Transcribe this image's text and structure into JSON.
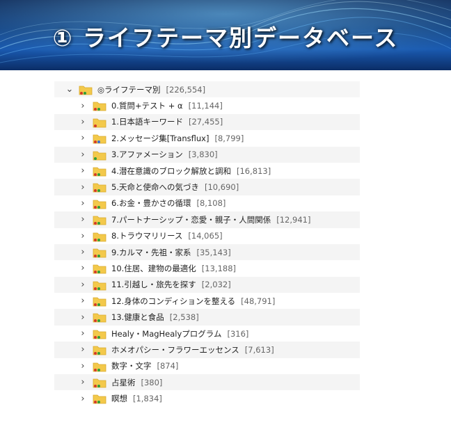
{
  "banner": {
    "title": "① ライフテーマ別データベース"
  },
  "colors": {
    "folder": "#f3c94b",
    "dot_red": "#d43a2a",
    "dot_green": "#2f9e3a",
    "dot_blue": "#3a6fd4"
  },
  "tree": {
    "root": {
      "label": "◎ライフテーマ別",
      "count": "[226,554]"
    },
    "items": [
      {
        "label": "0.質問+テスト + α",
        "count": "[11,144]",
        "dots": [
          "red",
          "green"
        ]
      },
      {
        "label": "1.日本語キーワード",
        "count": "[27,455]",
        "dots": [
          "red"
        ]
      },
      {
        "label": "2.メッセージ集[Transflux]",
        "count": "[8,799]",
        "dots": [
          "red",
          "blue"
        ]
      },
      {
        "label": "3.アファメーション",
        "count": "[3,830]",
        "dots": [
          "green"
        ]
      },
      {
        "label": "4.潜在意識のブロック解放と調和",
        "count": "[16,813]",
        "dots": [
          "red",
          "green"
        ]
      },
      {
        "label": "5.天命と使命への気づき",
        "count": "[10,690]",
        "dots": [
          "red",
          "green"
        ]
      },
      {
        "label": "6.お金・豊かさの循環",
        "count": "[8,108]",
        "dots": [
          "red",
          "green"
        ]
      },
      {
        "label": "7.パートナーシップ・恋愛・親子・人間関係",
        "count": "[12,941]",
        "dots": [
          "red",
          "green"
        ]
      },
      {
        "label": "8.トラウマリリース",
        "count": "[14,065]",
        "dots": [
          "red",
          "green"
        ]
      },
      {
        "label": "9.カルマ・先祖・家系",
        "count": "[35,143]",
        "dots": [
          "red",
          "green"
        ]
      },
      {
        "label": "10.住居、建物の最適化",
        "count": "[13,188]",
        "dots": [
          "red",
          "green"
        ]
      },
      {
        "label": "11.引越し・旅先を探す",
        "count": "[2,032]",
        "dots": [
          "red",
          "green"
        ]
      },
      {
        "label": "12.身体のコンディションを整える",
        "count": "[48,791]",
        "dots": [
          "red",
          "green"
        ]
      },
      {
        "label": "13.健康と食品",
        "count": "[2,538]",
        "dots": [
          "red",
          "green"
        ]
      },
      {
        "label": "Healy・MagHealyプログラム",
        "count": "[316]",
        "dots": [
          "red",
          "green"
        ]
      },
      {
        "label": "ホメオパシー・フラワーエッセンス",
        "count": "[7,613]",
        "dots": [
          "red",
          "green"
        ]
      },
      {
        "label": "数字・文字",
        "count": "[874]",
        "dots": [
          "red",
          "green"
        ]
      },
      {
        "label": "占星術",
        "count": "[380]",
        "dots": [
          "red",
          "green"
        ]
      },
      {
        "label": "瞑想",
        "count": "[1,834]",
        "dots": [
          "red",
          "green"
        ]
      }
    ]
  }
}
